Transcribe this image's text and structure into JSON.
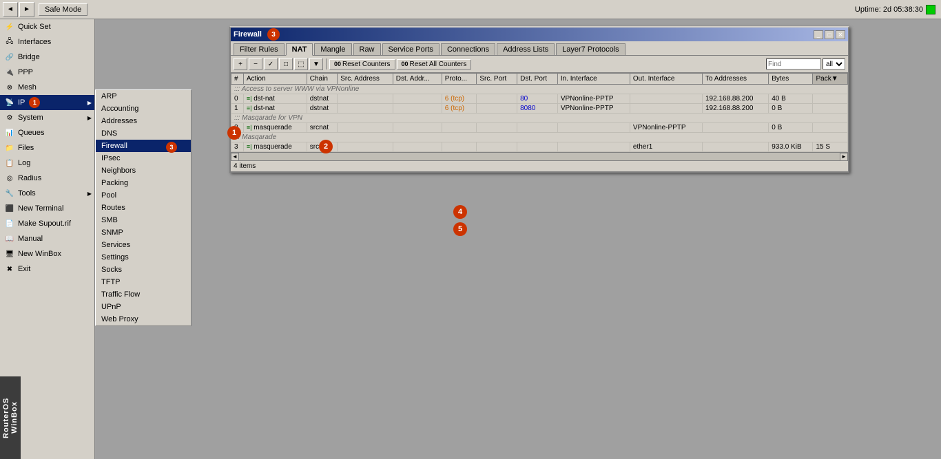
{
  "toolbar": {
    "back_label": "◄",
    "forward_label": "►",
    "safe_mode_label": "Safe Mode",
    "uptime_label": "Uptime: 2d 05:38:30"
  },
  "sidebar": {
    "items": [
      {
        "id": "quick-set",
        "label": "Quick Set",
        "icon": "⚡"
      },
      {
        "id": "interfaces",
        "label": "Interfaces",
        "icon": "🖧",
        "badge": null
      },
      {
        "id": "bridge",
        "label": "Bridge",
        "icon": "🔗"
      },
      {
        "id": "ppp",
        "label": "PPP",
        "icon": "🔌"
      },
      {
        "id": "mesh",
        "label": "Mesh",
        "icon": "⊗"
      },
      {
        "id": "ip",
        "label": "IP",
        "icon": "📡",
        "badge": "1",
        "arrow": true
      },
      {
        "id": "system",
        "label": "System",
        "icon": "⚙",
        "arrow": true
      },
      {
        "id": "queues",
        "label": "Queues",
        "icon": "📊"
      },
      {
        "id": "files",
        "label": "Files",
        "icon": "📁"
      },
      {
        "id": "log",
        "label": "Log",
        "icon": "📋"
      },
      {
        "id": "radius",
        "label": "Radius",
        "icon": "◎"
      },
      {
        "id": "tools",
        "label": "Tools",
        "icon": "🔧",
        "arrow": true
      },
      {
        "id": "new-terminal",
        "label": "New Terminal",
        "icon": "⬛"
      },
      {
        "id": "make-supout",
        "label": "Make Supout.rif",
        "icon": "📄"
      },
      {
        "id": "manual",
        "label": "Manual",
        "icon": "📖"
      },
      {
        "id": "new-winbox",
        "label": "New WinBox",
        "icon": "🖥"
      },
      {
        "id": "exit",
        "label": "Exit",
        "icon": "✖"
      }
    ]
  },
  "ip_menu": {
    "items": [
      "ARP",
      "Accounting",
      "Addresses",
      "DNS",
      "Firewall",
      "IPsec",
      "Neighbors",
      "Packing",
      "Pool",
      "Routes",
      "SMB",
      "SNMP",
      "Services",
      "Settings",
      "Socks",
      "TFTP",
      "Traffic Flow",
      "UPnP",
      "Web Proxy"
    ],
    "active": "Firewall"
  },
  "firewall_window": {
    "title": "Firewall",
    "badge": "3",
    "tabs": [
      {
        "id": "filter-rules",
        "label": "Filter Rules"
      },
      {
        "id": "nat",
        "label": "NAT",
        "active": true
      },
      {
        "id": "mangle",
        "label": "Mangle"
      },
      {
        "id": "raw",
        "label": "Raw"
      },
      {
        "id": "service-ports",
        "label": "Service Ports"
      },
      {
        "id": "connections",
        "label": "Connections"
      },
      {
        "id": "address-lists",
        "label": "Address Lists"
      },
      {
        "id": "layer7-protocols",
        "label": "Layer7 Protocols"
      }
    ],
    "toolbar": {
      "add": "+",
      "remove": "−",
      "edit": "✓",
      "copy": "□",
      "paste": "⬚",
      "filter": "▼",
      "reset_counters": "Reset Counters",
      "reset_all_counters": "Reset All Counters",
      "search_placeholder": "Find",
      "search_filter": "all"
    },
    "columns": [
      {
        "id": "num",
        "label": "#"
      },
      {
        "id": "action",
        "label": "Action"
      },
      {
        "id": "chain",
        "label": "Chain"
      },
      {
        "id": "src-address",
        "label": "Src. Address"
      },
      {
        "id": "dst-address",
        "label": "Dst. Addr..."
      },
      {
        "id": "proto",
        "label": "Proto..."
      },
      {
        "id": "src-port",
        "label": "Src. Port"
      },
      {
        "id": "dst-port",
        "label": "Dst. Port"
      },
      {
        "id": "in-interface",
        "label": "In. Interface"
      },
      {
        "id": "out-interface",
        "label": "Out. Interface"
      },
      {
        "id": "to-addresses",
        "label": "To Addresses"
      },
      {
        "id": "bytes",
        "label": "Bytes"
      },
      {
        "id": "pack",
        "label": "Pack▼"
      }
    ],
    "groups": [
      {
        "label": "::: Access to server WWW via VPNonline",
        "rows": [
          {
            "num": "0",
            "action": "dst-nat",
            "chain": "dstnat",
            "src_address": "",
            "dst_address": "",
            "proto": "6 (tcp)",
            "src_port": "",
            "dst_port": "80",
            "in_interface": "VPNonline-PPTP",
            "out_interface": "",
            "to_addresses": "192.168.88.200",
            "bytes": "40 B",
            "packets": ""
          },
          {
            "num": "1",
            "action": "dst-nat",
            "chain": "dstnat",
            "src_address": "",
            "dst_address": "",
            "proto": "6 (tcp)",
            "src_port": "",
            "dst_port": "8080",
            "in_interface": "VPNonline-PPTP",
            "out_interface": "",
            "to_addresses": "192.168.88.200",
            "bytes": "0 B",
            "packets": ""
          }
        ]
      },
      {
        "label": "::: Masqarade for VPN",
        "rows": [
          {
            "num": "2",
            "action": "masquerade",
            "chain": "srcnat",
            "src_address": "",
            "dst_address": "",
            "proto": "",
            "src_port": "",
            "dst_port": "",
            "in_interface": "",
            "out_interface": "VPNonline-PPTP",
            "to_addresses": "",
            "bytes": "0 B",
            "packets": ""
          }
        ]
      },
      {
        "label": "::: Masqarade",
        "rows": [
          {
            "num": "3",
            "action": "masquerade",
            "chain": "srcnat",
            "src_address": "",
            "dst_address": "",
            "proto": "",
            "src_port": "",
            "dst_port": "",
            "in_interface": "",
            "out_interface": "ether1",
            "to_addresses": "",
            "bytes": "933.0 KiB",
            "packets": "15 S"
          }
        ]
      }
    ],
    "status": "4 items"
  },
  "badges": {
    "ip_badge": "1",
    "fw_badge": "3",
    "fw_badge4": "4",
    "fw_badge5": "5"
  },
  "routeros_label": "RouterOS WinBox"
}
